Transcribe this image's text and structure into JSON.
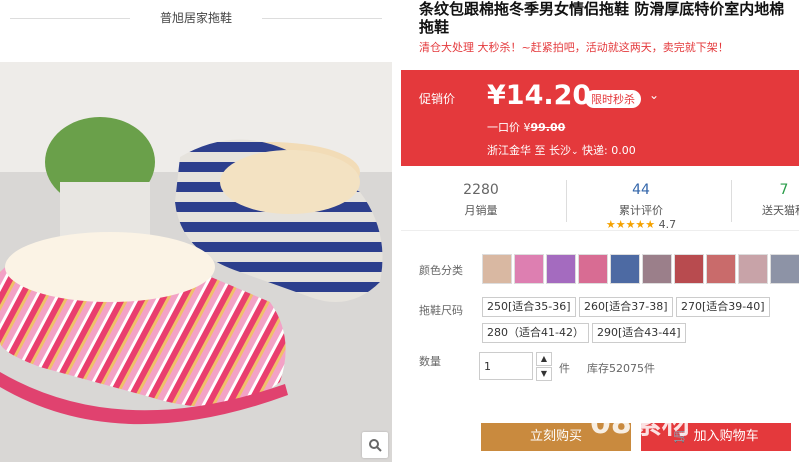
{
  "shop_title": "普旭居家拖鞋",
  "product": {
    "title": "条纹包跟棉拖冬季男女情侣拖鞋 防滑厚底特价室内地棉拖鞋",
    "subtitle": "清仓大处理 大秒杀！~赶紧拍吧，活动就这两天，卖完就下架！"
  },
  "promo": {
    "label": "促销价",
    "price": "¥14.20",
    "badge": "限时秒杀",
    "original_label": "一口价 ¥",
    "original_price": "99.00",
    "ship_from": "浙江金华",
    "ship_to_label": "至",
    "ship_to": "长沙",
    "ship_fee": "快递: 0.00",
    "colors": {
      "bg": "#e4393c",
      "text": "#ffffff"
    }
  },
  "stats": [
    {
      "value": "2280",
      "label": "月销量"
    },
    {
      "value": "44",
      "label": "累计评价",
      "rating": "4.7"
    },
    {
      "value": "7",
      "label": "送天猫积"
    }
  ],
  "color_row": {
    "label": "颜色分类",
    "swatches": [
      "#d9b8a2",
      "#dd7fb1",
      "#a46bbf",
      "#d86c93",
      "#4d6aa3",
      "#9b7f8a",
      "#b84b4f",
      "#c96b6b",
      "#c8a3a8",
      "#8d93a6"
    ]
  },
  "size_row": {
    "label": "拖鞋尺码",
    "options": [
      "250[适合35-36]",
      "260[适合37-38]",
      "270[适合39-40]",
      "280（适合41-42）",
      "290[适合43-44]"
    ]
  },
  "quantity": {
    "label": "数量",
    "value": "1",
    "unit": "件",
    "stock": "库存52075件"
  },
  "buttons": {
    "buy": "立刻购买",
    "cart": "加入购物车"
  },
  "watermark": "08素材"
}
